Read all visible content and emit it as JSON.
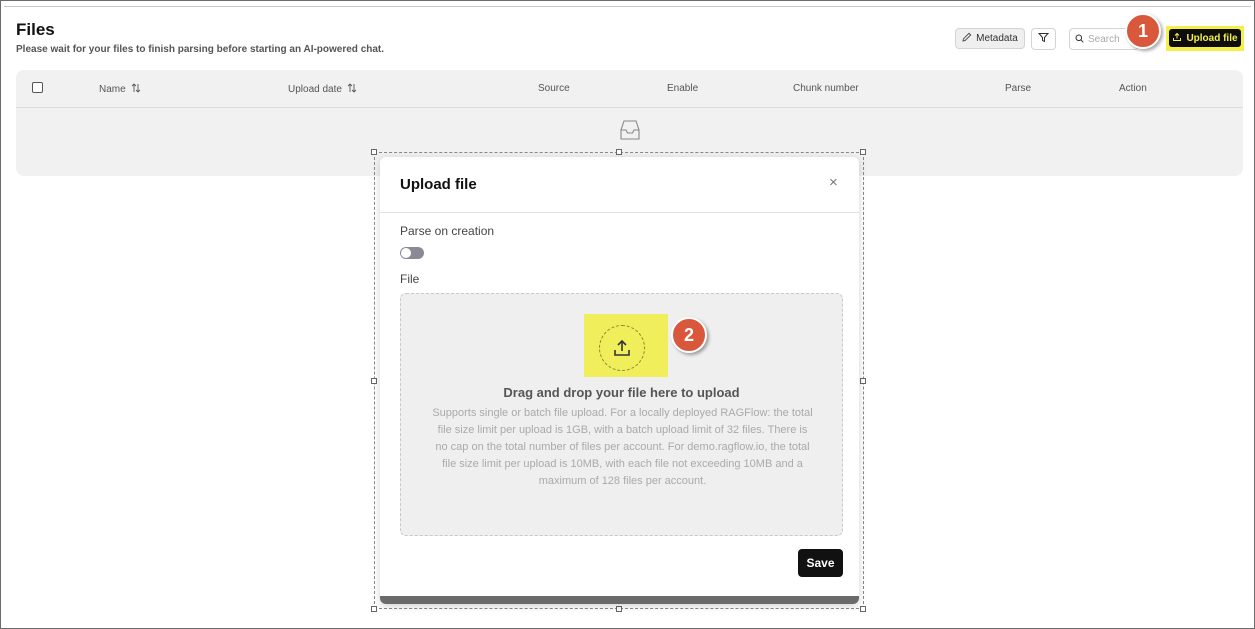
{
  "header": {
    "title": "Files",
    "subtitle": "Please wait for your files to finish parsing before starting an AI-powered chat."
  },
  "toolbar": {
    "metadata_label": "Metadata",
    "search_placeholder": "Search",
    "upload_label": "Upload file"
  },
  "table": {
    "columns": [
      "Name",
      "Upload date",
      "Source",
      "Enable",
      "Chunk number",
      "Parse",
      "Action"
    ]
  },
  "callouts": [
    "1",
    "2"
  ],
  "modal": {
    "title": "Upload file",
    "close_glyph": "×",
    "parse_label": "Parse on creation",
    "parse_enabled": false,
    "file_label": "File",
    "dropzone_title": "Drag and drop your file here to upload",
    "dropzone_description": "Supports single or batch file upload. For a locally deployed RAGFlow: the total file size limit per upload is 1GB, with a batch upload limit of 32 files. There is no cap on the total number of files per account. For demo.ragflow.io, the total file size limit per upload is 10MB, with each file not exceeding 10MB and a maximum of 128 files per account.",
    "save_label": "Save"
  },
  "icons": {
    "metadata": "pencil-icon",
    "filter": "filter-icon",
    "search": "search-icon",
    "upload": "upload-icon",
    "sort": "sort-icon",
    "empty": "inbox-icon",
    "close": "close-icon"
  },
  "colors": {
    "callout": "#d9573a",
    "highlight": "#f4ef4a",
    "primary_button": "#0d0d0d"
  }
}
